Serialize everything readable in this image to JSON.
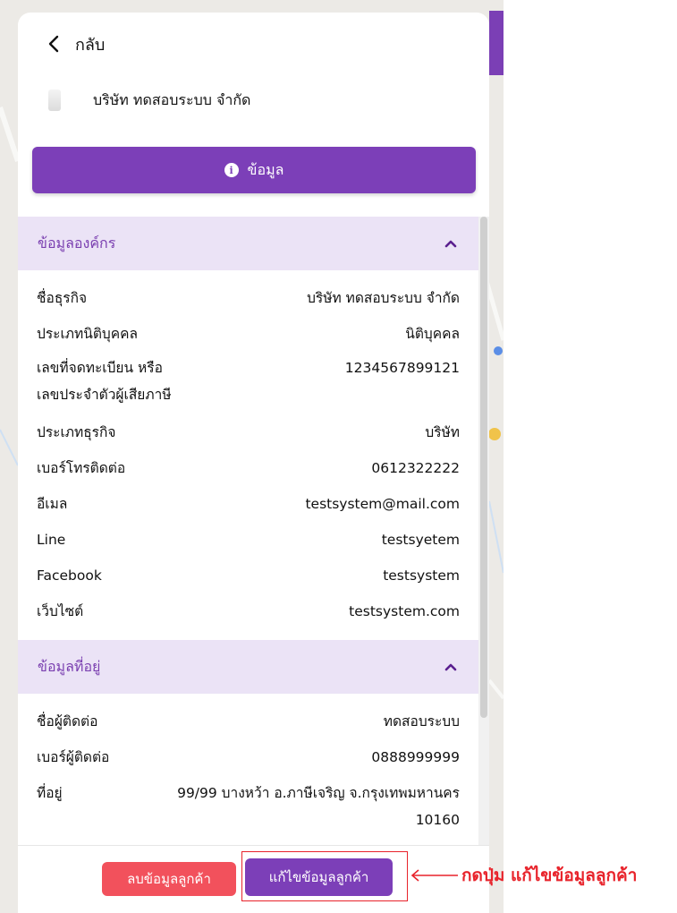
{
  "header": {
    "back_label": "กลับ",
    "company_name": "บริษัท ทดสอบระบบ จำกัด"
  },
  "info_button": {
    "label": "ข้อมูล",
    "icon": "info-icon"
  },
  "organization": {
    "title": "ข้อมูลองค์กร",
    "rows": [
      {
        "label": "ชื่อธุรกิจ",
        "value": "บริษัท ทดสอบระบบ จำกัด"
      },
      {
        "label": "ประเภทนิติบุคคล",
        "value": "นิติบุคคล"
      },
      {
        "label": "เลขที่จดทะเบียน หรือ",
        "label2": "เลขประจำตัวผู้เสียภาษี",
        "value": "1234567899121"
      },
      {
        "label": "ประเภทธุรกิจ",
        "value": "บริษัท"
      },
      {
        "label": "เบอร์โทรติดต่อ",
        "value": "0612322222"
      },
      {
        "label": "อีเมล",
        "value": "testsystem@mail.com"
      },
      {
        "label": "Line",
        "value": "testsyetem"
      },
      {
        "label": "Facebook",
        "value": "testsystem"
      },
      {
        "label": "เว็บไซต์",
        "value": "testsystem.com"
      }
    ]
  },
  "address": {
    "title": "ข้อมูลที่อยู่",
    "rows": [
      {
        "label": "ชื่อผู้ติดต่อ",
        "value": "ทดสอบระบบ"
      },
      {
        "label": "เบอร์ผู้ติดต่อ",
        "value": "0888999999"
      },
      {
        "label": "ที่อยู่",
        "value": "99/99 บางหว้า อ.ภาษีเจริญ จ.กรุงเทพมหานคร",
        "value2": "10160"
      }
    ]
  },
  "footer": {
    "delete_label": "ลบข้อมูลลูกค้า",
    "edit_label": "แก้ไขข้อมูลลูกค้า"
  },
  "annotation": {
    "text": "กดปุ่ม แก้ไขข้อมูลลูกค้า",
    "color": "#e8232b"
  },
  "colors": {
    "accent": "#7c3fb8",
    "danger": "#f2515c",
    "section_bg": "#ebe3f6"
  }
}
